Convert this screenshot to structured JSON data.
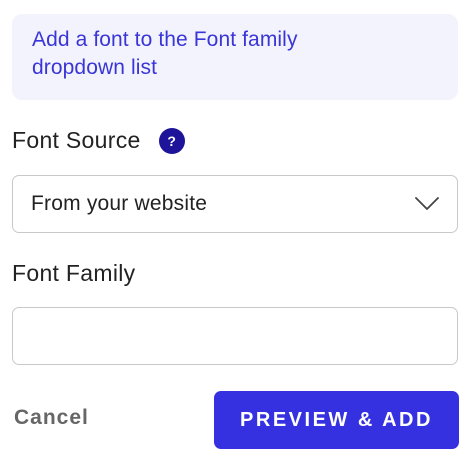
{
  "info": {
    "text_line1": "Add a font to the Font family",
    "text_line2": "dropdown list"
  },
  "font_source": {
    "label": "Font Source",
    "help_glyph": "?",
    "help_icon": "question-circle-icon",
    "selected_value": "From your website",
    "chevron_icon": "chevron-down-icon"
  },
  "font_family": {
    "label": "Font Family",
    "value": "",
    "placeholder": ""
  },
  "actions": {
    "cancel_label": "Cancel",
    "preview_add_label": "PREVIEW & ADD"
  },
  "colors": {
    "accent": "#3531e0",
    "info_background": "#f2f3fd",
    "info_text": "#3a35d6",
    "help_icon": "#1d1499",
    "border": "#c9c9cc",
    "cancel_text": "#666666"
  }
}
